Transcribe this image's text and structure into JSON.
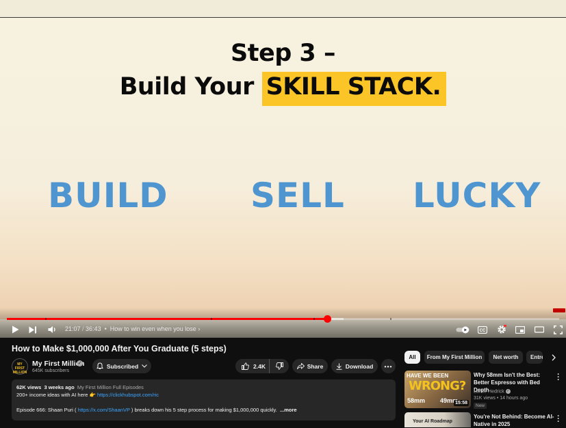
{
  "slide": {
    "step": "Step 3 –",
    "build_prefix": "Build Your ",
    "highlight": "SKILL STACK.",
    "words": [
      "BUILD",
      "SELL",
      "LUCKY"
    ],
    "highlight_color": "#fbc528",
    "word_color": "#4f96d0"
  },
  "player": {
    "current_time": "21:07",
    "separator": " / ",
    "duration": "36:43",
    "chapter": "How to win even when you lose",
    "progress_fraction": 0.58,
    "buffer_fraction": 0.61,
    "cc_label": "CC",
    "accent": "#ff0000"
  },
  "video": {
    "title": "How to Make $1,000,000 After You Graduate (5 steps)",
    "channel": "My First Million",
    "avatar_text": "MY FIRST MILLION",
    "subscribers": "645K subscribers",
    "subscribed_label": "Subscribed",
    "likes": "2.4K",
    "share_label": "Share",
    "download_label": "Download"
  },
  "description": {
    "views": "62K views",
    "age": "3 weeks ago",
    "tag": "My First Million Full Episodes",
    "line2_prefix": "200+ income ideas with AI here 👉 ",
    "line2_link": "https://clickhubspot.com/ric",
    "line3_prefix": "Episode 666: Shaan Puri ( ",
    "line3_link": "https://x.com/ShaanVP",
    "line3_suffix": " ) breaks down his 5 step process for making $1,000,000 quickly.",
    "more": "...more"
  },
  "sidebar": {
    "chips": [
      "All",
      "From My First Million",
      "Net worth",
      "Entre"
    ],
    "videos": [
      {
        "title": "Why 58mm Isn't the Best: Better Espresso with Bed Depth",
        "channel": "Lance Hedrick",
        "meta": "31K views • 14 hours ago",
        "badge": "New",
        "duration": "15:58",
        "thumb_top": "HAVE WE BEEN",
        "thumb_big": "WRONG?",
        "thumb_left": "58mm",
        "thumb_right": "49mm"
      },
      {
        "title": "You're Not Behind: Become AI-Native in 2025",
        "thumb_text": "Your AI Roadmap"
      }
    ]
  }
}
